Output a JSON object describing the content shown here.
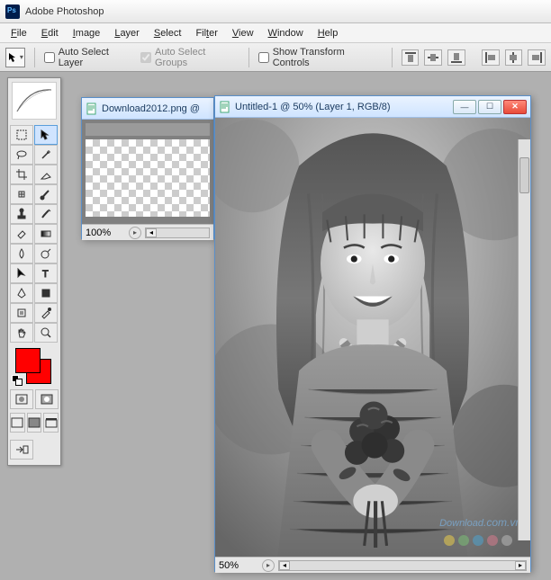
{
  "app": {
    "title": "Adobe Photoshop"
  },
  "menu": {
    "items": [
      "File",
      "Edit",
      "Image",
      "Layer",
      "Select",
      "Filter",
      "View",
      "Window",
      "Help"
    ]
  },
  "options": {
    "auto_select_layer": "Auto Select Layer",
    "auto_select_groups": "Auto Select Groups",
    "show_transform": "Show Transform Controls"
  },
  "colors": {
    "foreground": "#ff0000",
    "background": "#ff0000"
  },
  "doc1": {
    "title": "Download2012.png @",
    "zoom": "100%"
  },
  "doc2": {
    "title": "Untitled-1 @ 50% (Layer 1, RGB/8)",
    "zoom": "50%"
  },
  "watermark": {
    "text": "Download",
    "suffix": ".com.vn"
  },
  "dot_colors": [
    "#f5d547",
    "#7cc576",
    "#4aa8d8",
    "#e07b8f",
    "#c0c0c0"
  ]
}
